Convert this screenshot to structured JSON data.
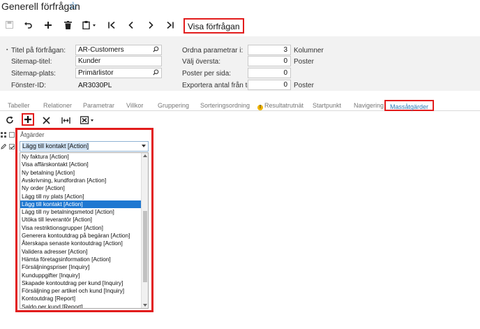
{
  "page": {
    "title": "Generell förfrågan"
  },
  "toolbar": {
    "visa_label": "Visa förfrågan"
  },
  "form": {
    "left": [
      {
        "label": "Titel på förfrågan:",
        "value": "AR-Customers"
      },
      {
        "label": "Sitemap-titel:",
        "value": "Kunder"
      },
      {
        "label": "Sitemap-plats:",
        "value": "Primärlistor"
      },
      {
        "label": "Fönster-ID:",
        "value": "AR3030PL"
      }
    ],
    "right": [
      {
        "label": "Ordna parametrar i:",
        "value": "3",
        "suffix": "Kolumner"
      },
      {
        "label": "Välj översta:",
        "value": "0",
        "suffix": "Poster"
      },
      {
        "label": "Poster per sida:",
        "value": "0",
        "suffix": ""
      },
      {
        "label": "Exportera antal från toppen:",
        "value": "0",
        "suffix": "Poster"
      }
    ]
  },
  "tabs": [
    "Tabeller",
    "Relationer",
    "Parametrar",
    "Villkor",
    "Gruppering",
    "Sorteringsordning",
    "Resultatrutnät",
    "Startpunkt",
    "Navigering",
    "Massåtgärder"
  ],
  "active_tab": "Massåtgärder",
  "grid": {
    "column_header": "Åtgärder",
    "selected_value": "Lägg till kontakt [Action]"
  },
  "dropdown": {
    "items": [
      "Ny faktura [Action]",
      "Visa affärskontakt [Action]",
      "Ny betalning [Action]",
      "Avskrivning, kundfordran [Action]",
      "Ny order [Action]",
      "Lägg till ny plats [Action]",
      "Lägg till kontakt [Action]",
      "Lägg till ny betalningsmetod [Action]",
      "Utöka till leverantör [Action]",
      "Visa restriktionsgrupper [Action]",
      "Generera kontoutdrag på begäran [Action]",
      "Återskapa senaste kontoutdrag [Action]",
      "Validera adresser [Action]",
      "Hämta företagsinformation [Action]",
      "Försäljningspriser [Inquiry]",
      "Kunduppgifter [Inquiry]",
      "Skapade kontoutdrag per kund [Inquiry]",
      "Försäljning per artikel och kund [Inquiry]",
      "Kontoutdrag [Report]",
      "Saldo per kund [Report]"
    ],
    "selected_index": 6
  },
  "colors": {
    "accent": "#2a7ab8",
    "highlight": "#e21c1c",
    "selection": "#1f78d1"
  }
}
